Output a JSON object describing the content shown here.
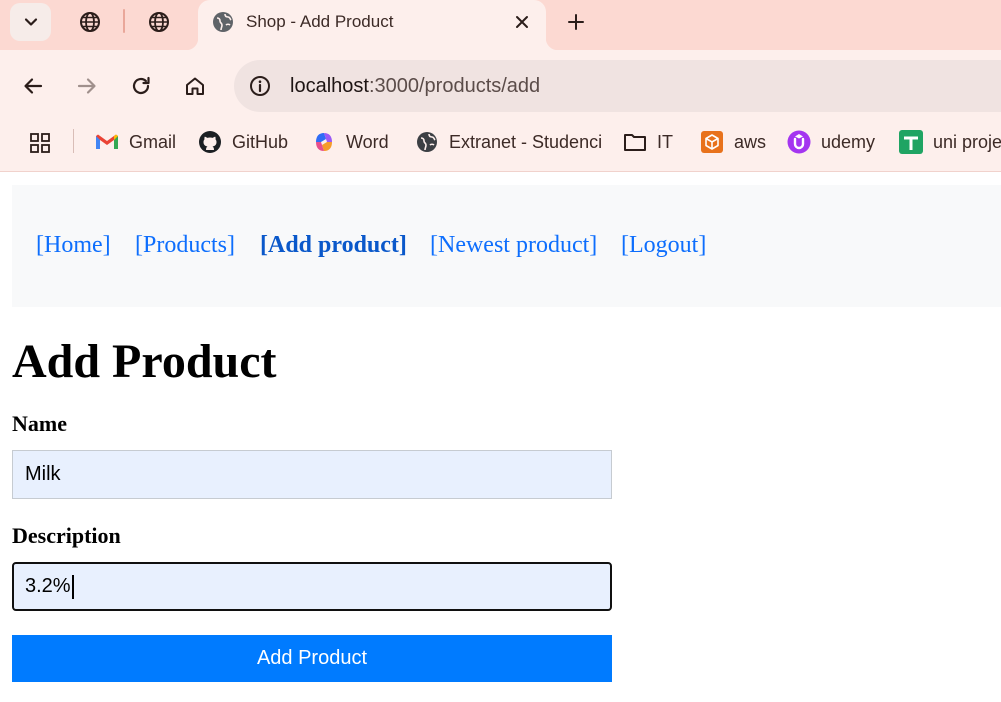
{
  "browser": {
    "active_tab": {
      "title": "Shop - Add Product",
      "favicon": "globe-icon"
    },
    "address_bar": {
      "host": "localhost",
      "path": ":3000/products/add"
    },
    "bookmarks": [
      {
        "label": "Gmail",
        "icon": "gmail-icon"
      },
      {
        "label": "GitHub",
        "icon": "github-icon"
      },
      {
        "label": "Word",
        "icon": "copilot-icon"
      },
      {
        "label": "Extranet - Studenci",
        "icon": "globe-icon"
      },
      {
        "label": "IT",
        "icon": "folder-icon"
      },
      {
        "label": "aws",
        "icon": "aws-icon"
      },
      {
        "label": "udemy",
        "icon": "udemy-icon"
      },
      {
        "label": "uni proje",
        "icon": "sheets-icon"
      }
    ]
  },
  "nav": {
    "links": [
      {
        "label": "[Home]"
      },
      {
        "label": "[Products]"
      },
      {
        "label": "[Add product]",
        "active": true
      },
      {
        "label": "[Newest product]"
      },
      {
        "label": "[Logout]"
      }
    ]
  },
  "form": {
    "title": "Add Product",
    "name_label": "Name",
    "name_value": "Milk",
    "description_label": "Description",
    "description_value": "3.2%",
    "submit_label": "Add Product"
  },
  "colors": {
    "link": "#0d6efd",
    "link_active": "#0a58ca",
    "button": "#007bff",
    "input_autofill": "#e8f0fe",
    "tabstrip": "#fcd9d2",
    "toolbar": "#fdefec"
  }
}
